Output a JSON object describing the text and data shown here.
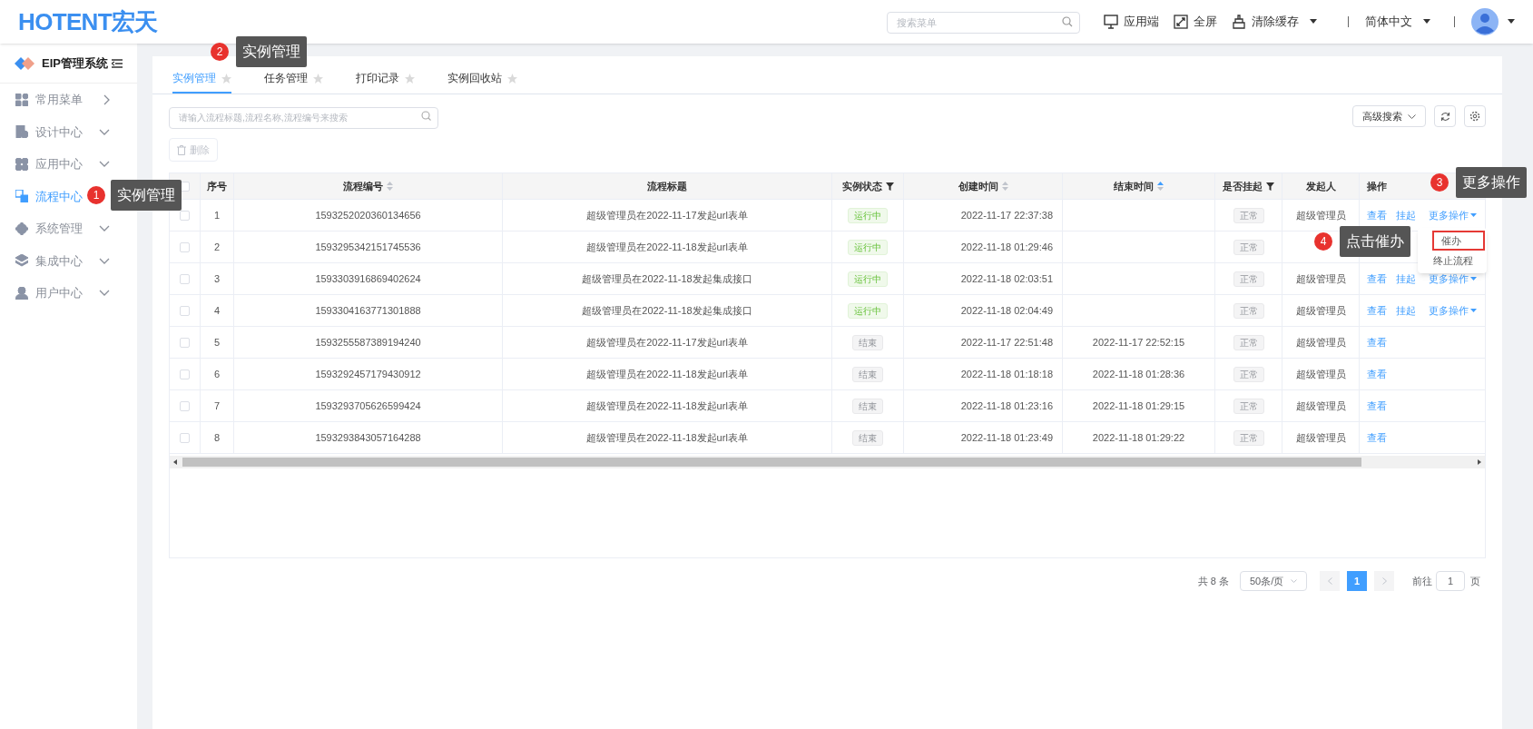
{
  "header": {
    "logo": "HOTENT宏天",
    "search": {
      "placeholder": "搜索菜单"
    },
    "actions": [
      {
        "kind": "monitor",
        "label": "应用端"
      },
      {
        "kind": "fullscreen",
        "label": "全屏"
      },
      {
        "kind": "clear",
        "label": "清除缓存",
        "dropdown": true
      },
      {
        "kind": "language",
        "label": "简体中文",
        "dropdown": true
      }
    ]
  },
  "sidebar": {
    "title": "EIP管理系统",
    "items": [
      {
        "label": "常用菜单",
        "kind": "flyout",
        "selected": false
      },
      {
        "label": "设计中心",
        "kind": "submenu",
        "selected": false
      },
      {
        "label": "应用中心",
        "kind": "submenu",
        "selected": false
      },
      {
        "label": "流程中心",
        "kind": "plain",
        "selected": true
      },
      {
        "label": "系统管理",
        "kind": "submenu",
        "selected": false
      },
      {
        "label": "集成中心",
        "kind": "submenu",
        "selected": false
      },
      {
        "label": "用户中心",
        "kind": "submenu",
        "selected": false
      }
    ]
  },
  "tabs": [
    {
      "label": "实例管理",
      "selected": true
    },
    {
      "label": "任务管理",
      "selected": false
    },
    {
      "label": "打印记录",
      "selected": false
    },
    {
      "label": "实例回收站",
      "selected": false
    }
  ],
  "search": {
    "placeholder": "请输入流程标题,流程名称,流程编号来搜索"
  },
  "toolbar": {
    "advanced_search": "高级搜索",
    "delete": {
      "label": "删除",
      "disabled": true
    }
  },
  "table": {
    "header_checked": false,
    "columns": [
      {
        "label": "序号"
      },
      {
        "label": "流程编号",
        "sortable": true,
        "sorted_ascending": false
      },
      {
        "label": "流程标题"
      },
      {
        "label": "实例状态",
        "filter": true
      },
      {
        "label": "创建时间",
        "sortable": true,
        "sorted_ascending": false
      },
      {
        "label": "结束时间",
        "sortable": true,
        "sorted_ascending": true
      },
      {
        "label": "是否挂起",
        "filter": true
      },
      {
        "label": "发起人"
      },
      {
        "label": "操作"
      }
    ],
    "rows": [
      {
        "checked": false,
        "index": "1",
        "number": "1593252020360134656",
        "title": "超级管理员在2022-11-17发起url表单",
        "status": {
          "label": "运行中",
          "kind": "running"
        },
        "created": "2022-11-17 22:37:38",
        "suspended": "正常",
        "initiator": "超级管理员",
        "ops": [
          {
            "label": "查看",
            "kind": "link"
          },
          {
            "label": "挂起",
            "kind": "link"
          },
          {
            "label": "更多操作",
            "kind": "more"
          }
        ]
      },
      {
        "checked": false,
        "index": "2",
        "number": "1593295342151745536",
        "title": "超级管理员在2022-11-18发起url表单",
        "status": {
          "label": "运行中",
          "kind": "running"
        },
        "created": "2022-11-18 01:29:46",
        "suspended": "正常"
      },
      {
        "checked": false,
        "index": "3",
        "number": "1593303916869402624",
        "title": "超级管理员在2022-11-18发起集成接口",
        "status": {
          "label": "运行中",
          "kind": "running"
        },
        "created": "2022-11-18 02:03:51",
        "suspended": "正常",
        "initiator": "超级管理员",
        "ops": [
          {
            "label": "查看",
            "kind": "link"
          },
          {
            "label": "挂起",
            "kind": "link"
          },
          {
            "label": "更多操作",
            "kind": "more"
          }
        ]
      },
      {
        "checked": false,
        "index": "4",
        "number": "1593304163771301888",
        "title": "超级管理员在2022-11-18发起集成接口",
        "status": {
          "label": "运行中",
          "kind": "running"
        },
        "created": "2022-11-18 02:04:49",
        "suspended": "正常",
        "initiator": "超级管理员",
        "ops": [
          {
            "label": "查看",
            "kind": "link"
          },
          {
            "label": "挂起",
            "kind": "link"
          },
          {
            "label": "更多操作",
            "kind": "more"
          }
        ]
      },
      {
        "checked": false,
        "index": "5",
        "number": "1593255587389194240",
        "title": "超级管理员在2022-11-17发起url表单",
        "status": {
          "label": "结束",
          "kind": "ended"
        },
        "created": "2022-11-17 22:51:48",
        "ended": "2022-11-17 22:52:15",
        "suspended": "正常",
        "initiator": "超级管理员",
        "ops": [
          {
            "label": "查看",
            "kind": "link"
          }
        ]
      },
      {
        "checked": false,
        "index": "6",
        "number": "1593292457179430912",
        "title": "超级管理员在2022-11-18发起url表单",
        "status": {
          "label": "结束",
          "kind": "ended"
        },
        "created": "2022-11-18 01:18:18",
        "ended": "2022-11-18 01:28:36",
        "suspended": "正常",
        "initiator": "超级管理员",
        "ops": [
          {
            "label": "查看",
            "kind": "link"
          }
        ]
      },
      {
        "checked": false,
        "index": "7",
        "number": "1593293705626599424",
        "title": "超级管理员在2022-11-18发起url表单",
        "status": {
          "label": "结束",
          "kind": "ended"
        },
        "created": "2022-11-18 01:23:16",
        "ended": "2022-11-18 01:29:15",
        "suspended": "正常",
        "initiator": "超级管理员",
        "ops": [
          {
            "label": "查看",
            "kind": "link"
          }
        ]
      },
      {
        "checked": false,
        "index": "8",
        "number": "1593293843057164288",
        "title": "超级管理员在2022-11-18发起url表单",
        "status": {
          "label": "结束",
          "kind": "ended"
        },
        "created": "2022-11-18 01:23:49",
        "ended": "2022-11-18 01:29:22",
        "suspended": "正常",
        "initiator": "超级管理员",
        "ops": [
          {
            "label": "查看",
            "kind": "link"
          }
        ]
      }
    ]
  },
  "dropdown_menu": [
    {
      "label": "催办",
      "highlighted": true
    },
    {
      "label": "终止流程",
      "highlighted": false
    }
  ],
  "pagination": {
    "total": "共 8 条",
    "page_size": "50条/页",
    "pages": [
      {
        "label": "1",
        "selected": true
      }
    ],
    "goto": "前往",
    "goto_value": "1",
    "page_unit": "页"
  },
  "annotations": [
    {
      "number": "1",
      "text": "实例管理",
      "kind": "sidebar"
    },
    {
      "number": "2",
      "text": "实例管理",
      "kind": "tab"
    },
    {
      "number": "3",
      "text": "更多操作",
      "kind": "header"
    },
    {
      "number": "4",
      "text": "点击催办",
      "kind": "menu"
    }
  ]
}
